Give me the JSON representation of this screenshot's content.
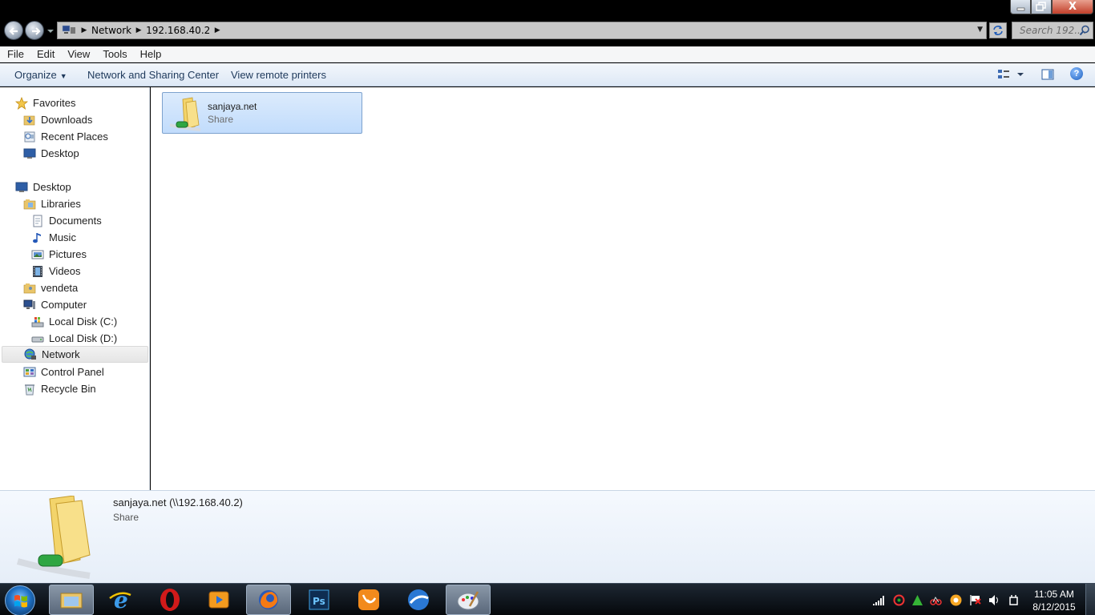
{
  "window": {
    "close_label": "X"
  },
  "address": {
    "crumbs": [
      "Network",
      "192.168.40.2"
    ],
    "search_placeholder": "Search 192...."
  },
  "menu": {
    "items": [
      "File",
      "Edit",
      "View",
      "Tools",
      "Help"
    ]
  },
  "toolbar": {
    "organize": "Organize",
    "network_center": "Network and Sharing Center",
    "remote_printers": "View remote printers",
    "help": "?"
  },
  "navigation": {
    "favorites": "Favorites",
    "downloads": "Downloads",
    "recent_places": "Recent Places",
    "desktop_fav": "Desktop",
    "desktop": "Desktop",
    "libraries": "Libraries",
    "documents": "Documents",
    "music": "Music",
    "pictures": "Pictures",
    "videos": "Videos",
    "vendeta": "vendeta",
    "computer": "Computer",
    "disk_c": "Local Disk (C:)",
    "disk_d": "Local Disk (D:)",
    "network": "Network",
    "control_panel": "Control Panel",
    "recycle_bin": "Recycle Bin"
  },
  "content": {
    "items": [
      {
        "name": "sanjaya.net",
        "type": "Share"
      }
    ]
  },
  "details": {
    "name": "sanjaya.net (\\\\192.168.40.2)",
    "type": "Share"
  },
  "taskbar": {
    "time": "11:05 AM",
    "date": "8/12/2015",
    "apps": [
      "windows-explorer",
      "internet-explorer",
      "opera",
      "media-player",
      "firefox",
      "photoshop",
      "uc-browser",
      "browser-globe",
      "paint"
    ]
  },
  "colors": {
    "selection": "#cce4fc",
    "command_bar": "#dde8f5",
    "taskbar": "#0b1118"
  }
}
